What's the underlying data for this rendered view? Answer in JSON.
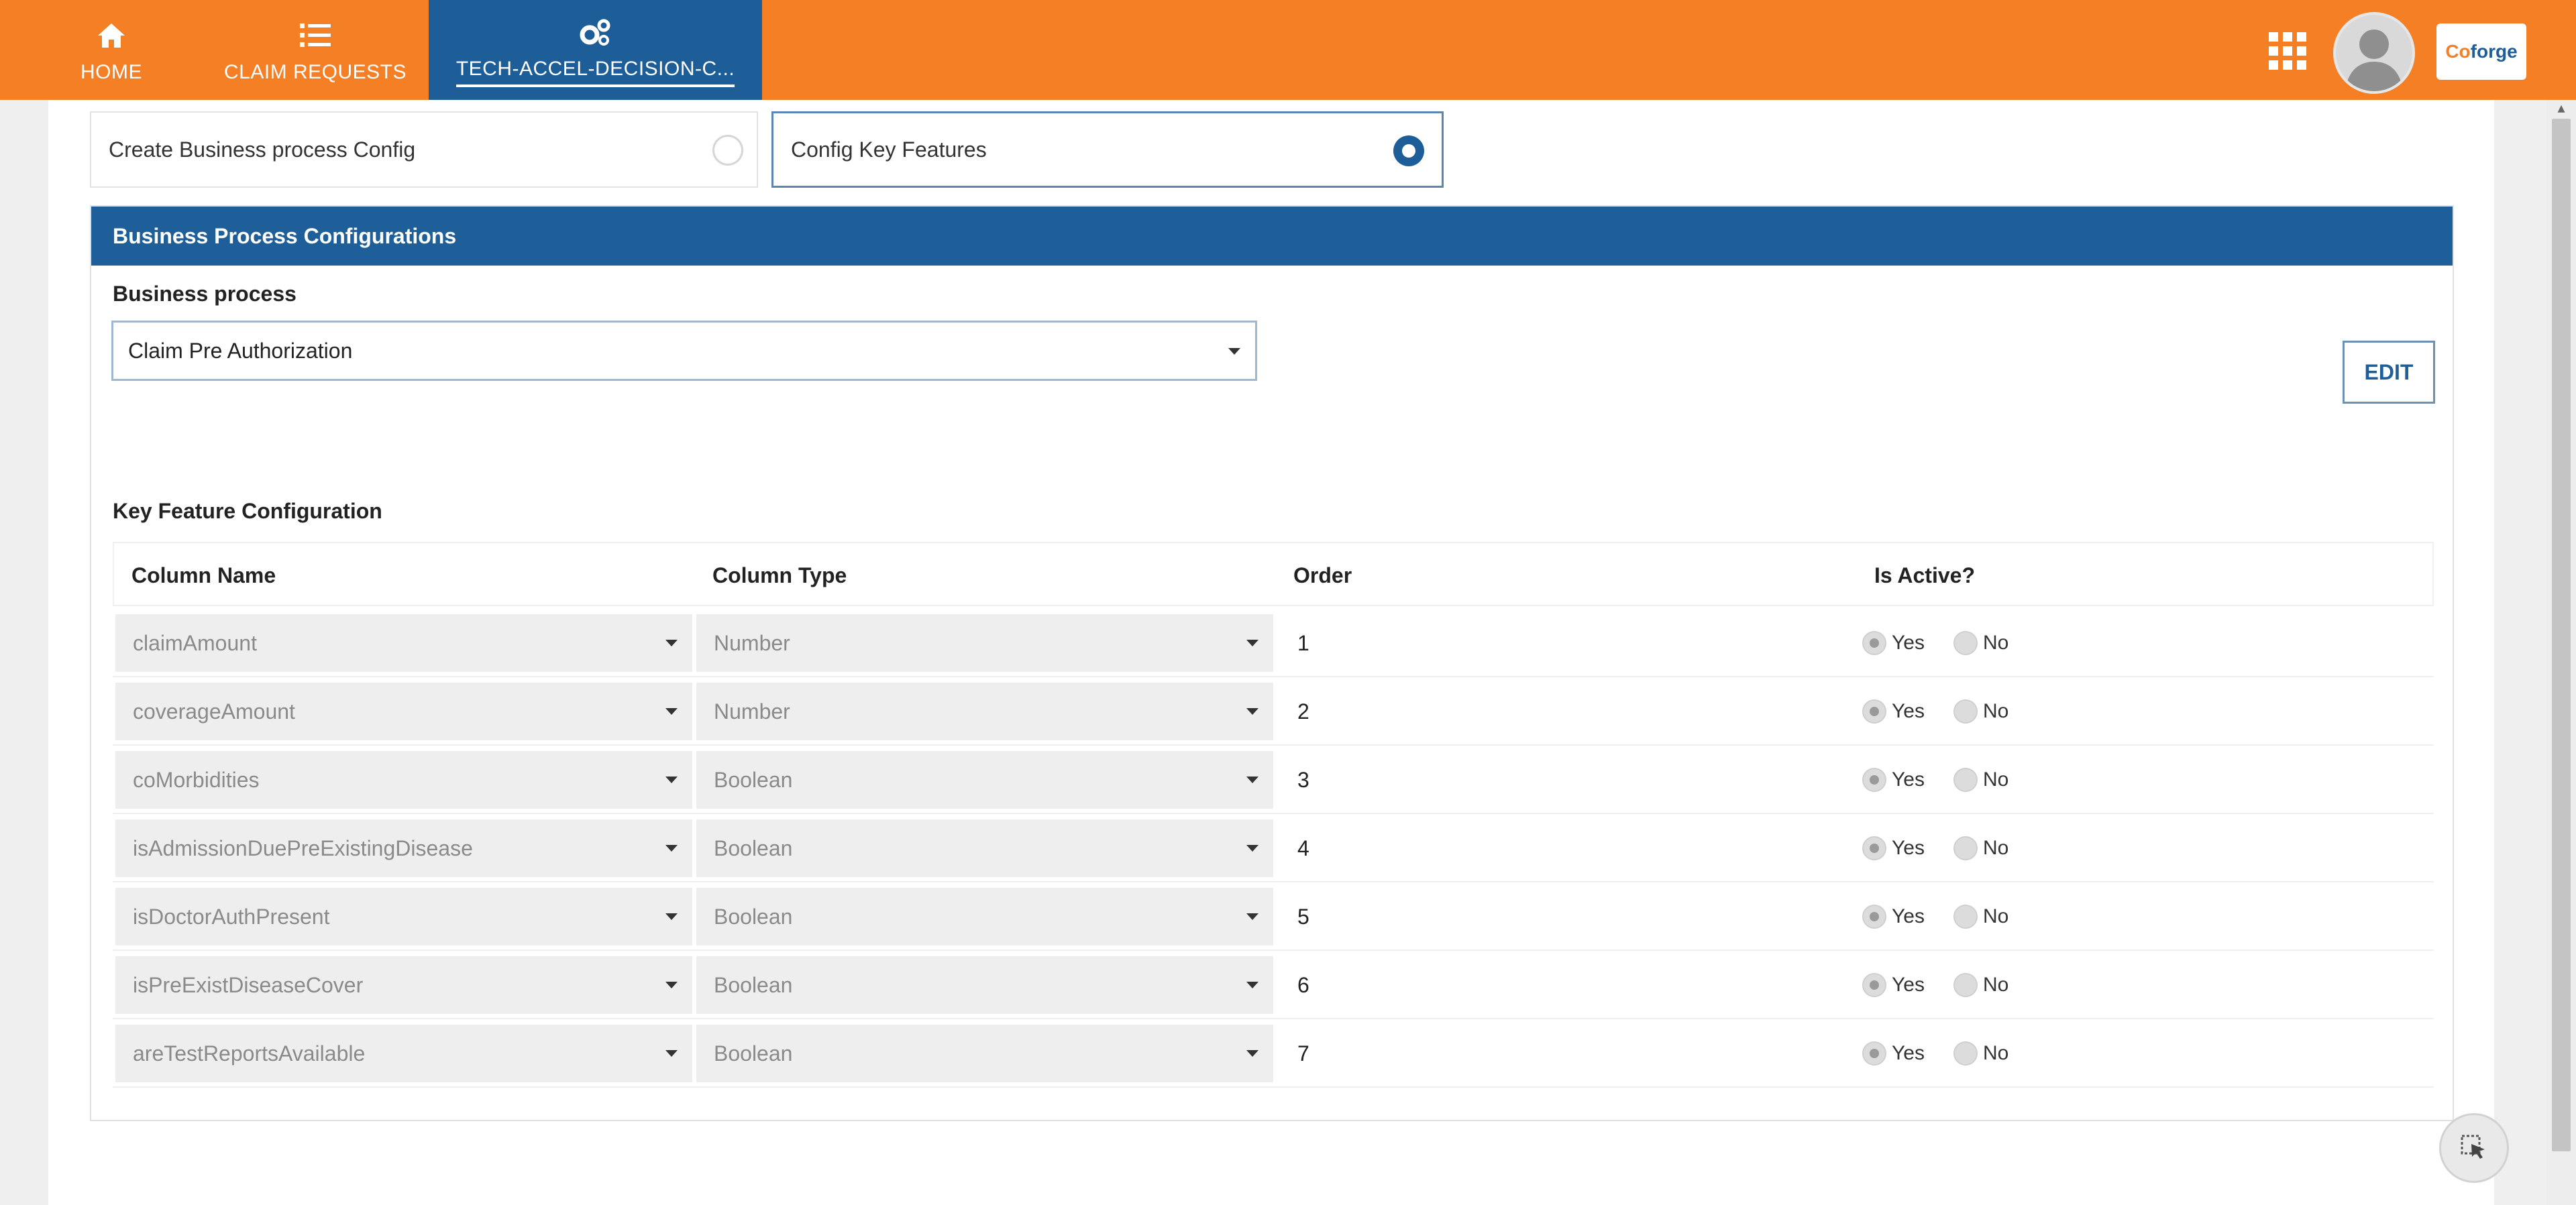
{
  "nav": {
    "tabs": [
      {
        "label": "HOME",
        "icon": "home-icon"
      },
      {
        "label": "CLAIM REQUESTS",
        "icon": "list-icon"
      },
      {
        "label": "TECH-ACCEL-DECISION-C...",
        "icon": "gears-icon"
      }
    ],
    "brand_prefix": "Co",
    "brand_highlight": "",
    "brand_suffix": "forge"
  },
  "options": {
    "create": "Create Business process Config",
    "config": "Config Key Features",
    "selected": "config"
  },
  "panel": {
    "title": "Business Process Configurations",
    "business_process_label": "Business process",
    "business_process_value": "Claim Pre Authorization",
    "edit_label": "EDIT",
    "key_feature_label": "Key Feature Configuration"
  },
  "table": {
    "headers": [
      "Column Name",
      "Column Type",
      "Order",
      "Is Active?"
    ],
    "yes_label": "Yes",
    "no_label": "No",
    "rows": [
      {
        "name": "claimAmount",
        "type": "Number",
        "order": "1",
        "active": "yes"
      },
      {
        "name": "coverageAmount",
        "type": "Number",
        "order": "2",
        "active": "yes"
      },
      {
        "name": "coMorbidities",
        "type": "Boolean",
        "order": "3",
        "active": "yes"
      },
      {
        "name": "isAdmissionDuePreExistingDisease",
        "type": "Boolean",
        "order": "4",
        "active": "yes"
      },
      {
        "name": "isDoctorAuthPresent",
        "type": "Boolean",
        "order": "5",
        "active": "yes"
      },
      {
        "name": "isPreExistDiseaseCover",
        "type": "Boolean",
        "order": "6",
        "active": "yes"
      },
      {
        "name": "areTestReportsAvailable",
        "type": "Boolean",
        "order": "7",
        "active": "yes"
      }
    ]
  },
  "colors": {
    "header_orange": "#f57f25",
    "primary_blue": "#1f5f99"
  },
  "icons": {
    "apps": "grid-icon",
    "user": "avatar-icon",
    "scroll_up": "chevron-up-icon",
    "fab": "cursor-select-icon"
  }
}
